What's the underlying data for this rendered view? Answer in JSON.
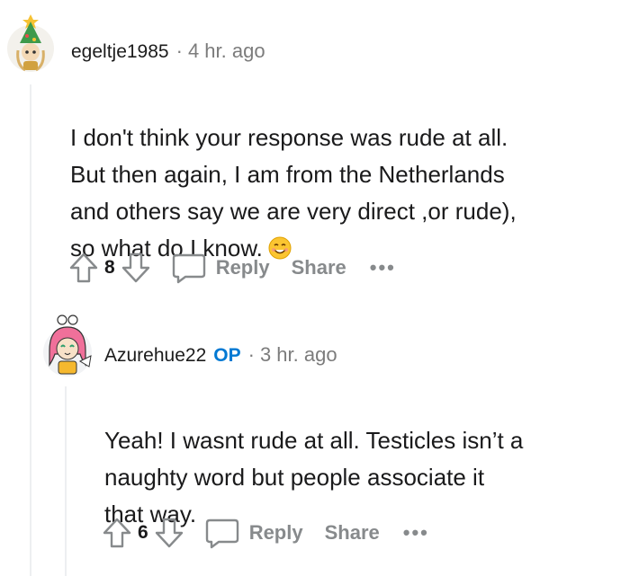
{
  "comments": [
    {
      "username": "egeltje1985",
      "separator": "·",
      "time": "4 hr. ago",
      "body": "I don't think your response was rude at all.\nBut then again, I am from the Netherlands\nand others say we are very direct ,or rude),\nso what do I know.",
      "emoji": "smiling-face-icon",
      "score": "8",
      "reply_label": "Reply",
      "share_label": "Share",
      "more_label": "•••"
    },
    {
      "username": "Azurehue22",
      "op_label": "OP",
      "separator": "·",
      "time": "3 hr. ago",
      "body": "Yeah! I wasnt rude at all. Testicles isn’t a\nnaughty word but people associate it\nthat way.",
      "score": "6",
      "reply_label": "Reply",
      "share_label": "Share",
      "more_label": "•••"
    }
  ],
  "colors": {
    "op_blue": "#0079d3",
    "meta_gray": "#7c7c7c",
    "action_gray": "#878a8c",
    "thread_line": "#edeff1"
  }
}
